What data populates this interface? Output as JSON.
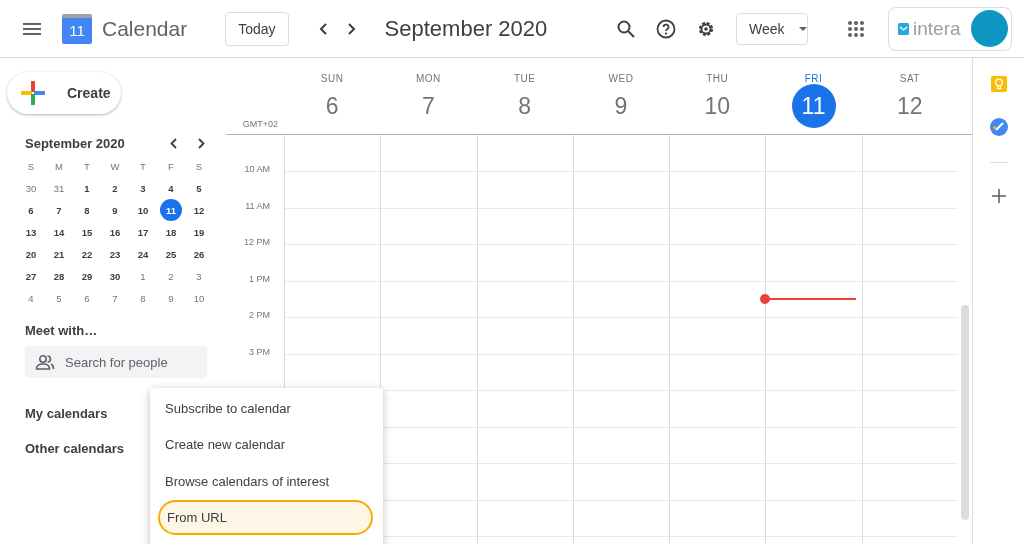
{
  "header": {
    "logo_day": "11",
    "app_name": "Calendar",
    "today_button": "Today",
    "period_title": "September 2020",
    "view_selector": "Week",
    "account_logo": "intera"
  },
  "sidebar": {
    "create_button": "Create",
    "mini_calendar": {
      "title": "September 2020",
      "weekdays": [
        "S",
        "M",
        "T",
        "W",
        "T",
        "F",
        "S"
      ],
      "weeks": [
        [
          {
            "day": "30",
            "in_month": false,
            "selected": false
          },
          {
            "day": "31",
            "in_month": false,
            "selected": false
          },
          {
            "day": "1",
            "in_month": true,
            "selected": false
          },
          {
            "day": "2",
            "in_month": true,
            "selected": false
          },
          {
            "day": "3",
            "in_month": true,
            "selected": false
          },
          {
            "day": "4",
            "in_month": true,
            "selected": false
          },
          {
            "day": "5",
            "in_month": true,
            "selected": false
          }
        ],
        [
          {
            "day": "6",
            "in_month": true,
            "selected": false
          },
          {
            "day": "7",
            "in_month": true,
            "selected": false
          },
          {
            "day": "8",
            "in_month": true,
            "selected": false
          },
          {
            "day": "9",
            "in_month": true,
            "selected": false
          },
          {
            "day": "10",
            "in_month": true,
            "selected": false
          },
          {
            "day": "11",
            "in_month": true,
            "selected": true
          },
          {
            "day": "12",
            "in_month": true,
            "selected": false
          }
        ],
        [
          {
            "day": "13",
            "in_month": true,
            "selected": false
          },
          {
            "day": "14",
            "in_month": true,
            "selected": false
          },
          {
            "day": "15",
            "in_month": true,
            "selected": false
          },
          {
            "day": "16",
            "in_month": true,
            "selected": false
          },
          {
            "day": "17",
            "in_month": true,
            "selected": false
          },
          {
            "day": "18",
            "in_month": true,
            "selected": false
          },
          {
            "day": "19",
            "in_month": true,
            "selected": false
          }
        ],
        [
          {
            "day": "20",
            "in_month": true,
            "selected": false
          },
          {
            "day": "21",
            "in_month": true,
            "selected": false
          },
          {
            "day": "22",
            "in_month": true,
            "selected": false
          },
          {
            "day": "23",
            "in_month": true,
            "selected": false
          },
          {
            "day": "24",
            "in_month": true,
            "selected": false
          },
          {
            "day": "25",
            "in_month": true,
            "selected": false
          },
          {
            "day": "26",
            "in_month": true,
            "selected": false
          }
        ],
        [
          {
            "day": "27",
            "in_month": true,
            "selected": false
          },
          {
            "day": "28",
            "in_month": true,
            "selected": false
          },
          {
            "day": "29",
            "in_month": true,
            "selected": false
          },
          {
            "day": "30",
            "in_month": true,
            "selected": false
          },
          {
            "day": "1",
            "in_month": false,
            "selected": false
          },
          {
            "day": "2",
            "in_month": false,
            "selected": false
          },
          {
            "day": "3",
            "in_month": false,
            "selected": false
          }
        ],
        [
          {
            "day": "4",
            "in_month": false,
            "selected": false
          },
          {
            "day": "5",
            "in_month": false,
            "selected": false
          },
          {
            "day": "6",
            "in_month": false,
            "selected": false
          },
          {
            "day": "7",
            "in_month": false,
            "selected": false
          },
          {
            "day": "8",
            "in_month": false,
            "selected": false
          },
          {
            "day": "9",
            "in_month": false,
            "selected": false
          },
          {
            "day": "10",
            "in_month": false,
            "selected": false
          }
        ]
      ]
    },
    "meet_with": {
      "heading": "Meet with…",
      "placeholder": "Search for people"
    },
    "sections": [
      "My calendars",
      "Other calendars"
    ]
  },
  "week_view": {
    "timezone": "GMT+02",
    "days": [
      {
        "weekday": "SUN",
        "date": "6",
        "selected": false,
        "current_time": false
      },
      {
        "weekday": "MON",
        "date": "7",
        "selected": false,
        "current_time": false
      },
      {
        "weekday": "TUE",
        "date": "8",
        "selected": false,
        "current_time": false
      },
      {
        "weekday": "WED",
        "date": "9",
        "selected": false,
        "current_time": false
      },
      {
        "weekday": "THU",
        "date": "10",
        "selected": false,
        "current_time": false
      },
      {
        "weekday": "FRI",
        "date": "11",
        "selected": true,
        "current_time": true
      },
      {
        "weekday": "SAT",
        "date": "12",
        "selected": false,
        "current_time": false
      }
    ],
    "hours": [
      "10 AM",
      "11 AM",
      "12 PM",
      "1 PM",
      "2 PM",
      "3 PM"
    ]
  },
  "menu": {
    "items": [
      {
        "label": "Subscribe to calendar",
        "highlighted": false
      },
      {
        "label": "Create new calendar",
        "highlighted": false
      },
      {
        "label": "Browse calendars of interest",
        "highlighted": false
      },
      {
        "label": "From URL",
        "highlighted": true
      }
    ]
  }
}
